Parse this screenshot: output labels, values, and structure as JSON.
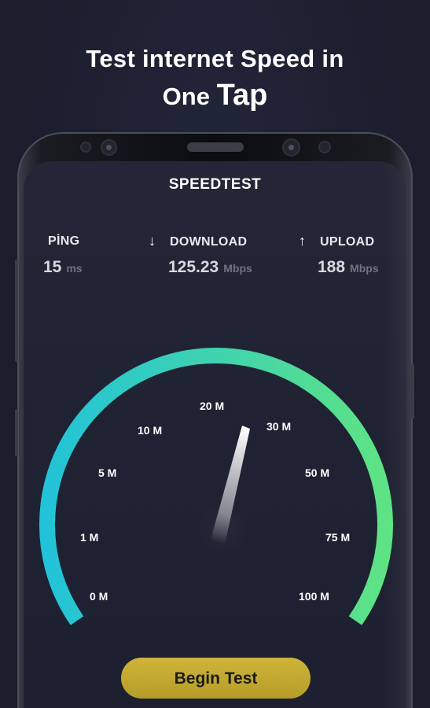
{
  "headline": {
    "line1": "Test internet Speed in",
    "line2_prefix": "One",
    "line2_emphasis": "Tap"
  },
  "app": {
    "title": "SPEEDTEST"
  },
  "metrics": {
    "ping": {
      "label": "PİNG",
      "value": "15",
      "unit": "ms"
    },
    "download": {
      "label": "DOWNLOAD",
      "value": "125.23",
      "unit": "Mbps",
      "icon": "arrow-down-icon"
    },
    "upload": {
      "label": "UPLOAD",
      "value": "188",
      "unit": "Mbps",
      "icon": "arrow-up-icon"
    }
  },
  "gauge": {
    "ticks": [
      "0 M",
      "1 M",
      "5 M",
      "10 M",
      "20 M",
      "30 M",
      "50 M",
      "75 M",
      "100 M"
    ],
    "needle_value_label": "30 M",
    "colors": {
      "start": "#22c3d8",
      "end": "#5ee384"
    }
  },
  "button": {
    "label": "Begin Test",
    "color": "#c6ad33"
  }
}
